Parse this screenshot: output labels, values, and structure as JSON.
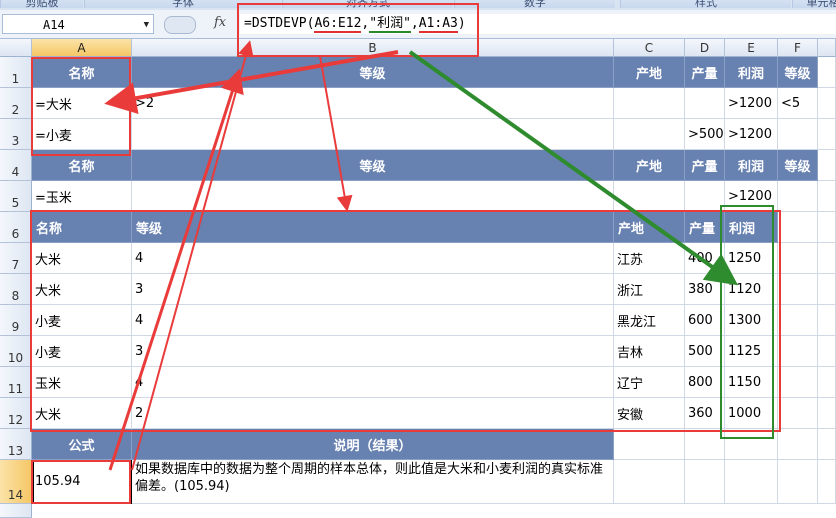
{
  "ribbon": {
    "groups": [
      "剪贴板",
      "字体",
      "对齐方式",
      "数字",
      "样式",
      "单元格"
    ]
  },
  "name_box": "A14",
  "fx_label": "fx",
  "formula": {
    "prefix": "=DSTDEVP(",
    "range": "A6:E12",
    "sep1": ",",
    "field": "\"利润\"",
    "sep2": ",",
    "criteria": "A1:A3",
    "suffix": ")"
  },
  "columns": [
    "A",
    "B",
    "C",
    "D",
    "E",
    "F"
  ],
  "rows": [
    "1",
    "2",
    "3",
    "4",
    "5",
    "6",
    "7",
    "8",
    "9",
    "10",
    "11",
    "12",
    "13",
    "14"
  ],
  "criteria_header": [
    "名称",
    "等级",
    "产地",
    "产量",
    "利润",
    "等级"
  ],
  "criteria_row2": [
    "=大米",
    ">2",
    "",
    "",
    ">1200",
    "<5"
  ],
  "criteria_row3": [
    "=小麦",
    "",
    "",
    ">500",
    ">1200",
    ""
  ],
  "criteria_header2": [
    "名称",
    "等级",
    "产地",
    "产量",
    "利润",
    "等级"
  ],
  "criteria_row5": [
    "=玉米",
    "",
    "",
    "",
    ">1200",
    ""
  ],
  "db_header": [
    "名称",
    "等级",
    "产地",
    "产量",
    "利润"
  ],
  "db_rows": [
    [
      "大米",
      "4",
      "江苏",
      "400",
      "1250"
    ],
    [
      "大米",
      "3",
      "浙江",
      "380",
      "1120"
    ],
    [
      "小麦",
      "4",
      "黑龙江",
      "600",
      "1300"
    ],
    [
      "小麦",
      "3",
      "吉林",
      "500",
      "1125"
    ],
    [
      "玉米",
      "4",
      "辽宁",
      "800",
      "1150"
    ],
    [
      "大米",
      "2",
      "安徽",
      "360",
      "1000"
    ]
  ],
  "result_header": {
    "formula": "公式",
    "desc": "说明（结果）"
  },
  "result": {
    "value": "105.94",
    "desc": "如果数据库中的数据为整个周期的样本总体，则此值是大米和小麦利润的真实标准偏差。(105.94)"
  }
}
